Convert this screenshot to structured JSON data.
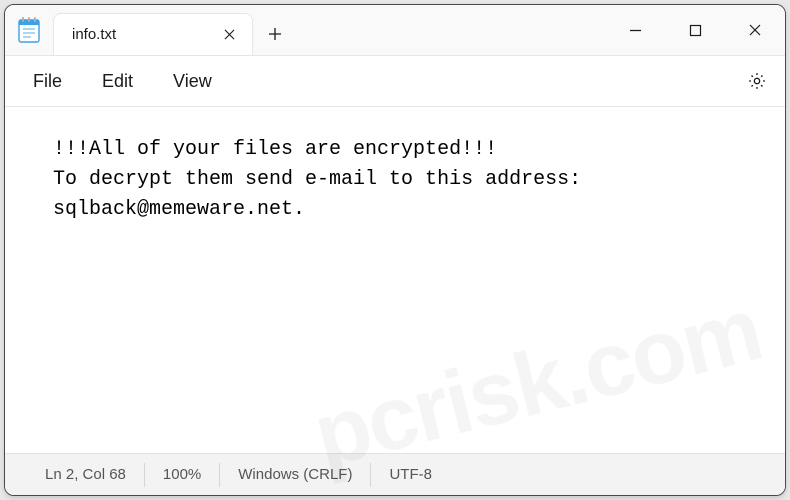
{
  "tab": {
    "title": "info.txt"
  },
  "menu": {
    "file": "File",
    "edit": "Edit",
    "view": "View"
  },
  "content": {
    "line1": "!!!All of your files are encrypted!!!",
    "line2": "To decrypt them send e-mail to this address:",
    "line3": "sqlback@memeware.net."
  },
  "status": {
    "position": "Ln 2, Col 68",
    "zoom": "100%",
    "eol": "Windows (CRLF)",
    "encoding": "UTF-8"
  },
  "watermark": "pcrisk.com"
}
